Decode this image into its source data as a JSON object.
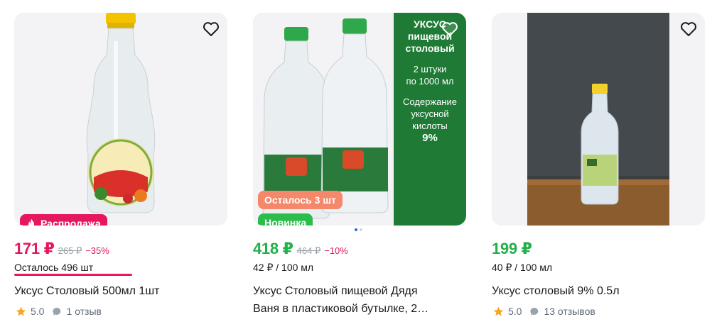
{
  "colors": {
    "sale": "#e5175f",
    "green_price": "#22b04a",
    "new_badge": "#2bbd4a",
    "left_badge": "#f5876a",
    "star": "#f5a623"
  },
  "products": [
    {
      "image_icon": "vinegar-bottle-image",
      "badge": "Распродажа",
      "price": "171 ₽",
      "old_price": "265 ₽",
      "discount": "−35%",
      "stock": "Осталось 496 шт",
      "title": "Уксус Столовый 500мл 1шт",
      "rating": "5.0",
      "reviews": "1 отзыв"
    },
    {
      "image_icon": "vinegar-two-bottles-image",
      "banner_lines": [
        "УКСУС",
        "пищевой",
        "столовый"
      ],
      "banner_qty": [
        "2 штуки",
        "по 1000 мл"
      ],
      "banner_acid": [
        "Содержание",
        "уксусной",
        "кислоты"
      ],
      "banner_percent": "9%",
      "badge_left": "Осталось 3 шт",
      "badge_new": "Новинка",
      "price": "418 ₽",
      "old_price": "464 ₽",
      "discount": "−10%",
      "unit_price": "42 ₽ / 100 мл",
      "title_line1": "Уксус Столовый пищевой Дядя",
      "title_line2": "Ваня в пластиковой бутылке, 2…"
    },
    {
      "image_icon": "vinegar-bottle-photo-image",
      "price": "199 ₽",
      "unit_price": "40 ₽ / 100 мл",
      "title": "Уксус столовый 9% 0.5л",
      "rating": "5.0",
      "reviews": "13 отзывов"
    }
  ]
}
